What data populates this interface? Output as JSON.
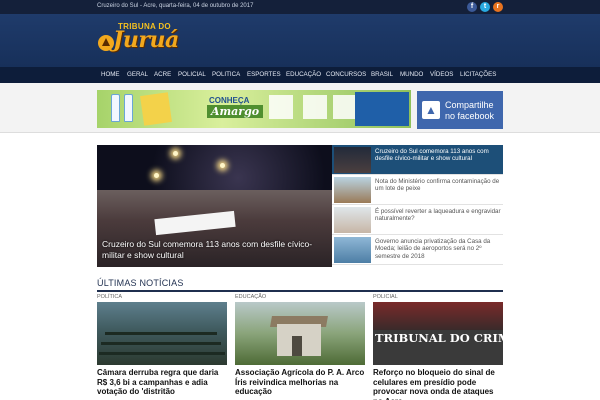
{
  "topbar": {
    "date": "Cruzeiro do Sul - Acre, quarta-feira, 04 de outubro de 2017",
    "social": [
      "f",
      "t",
      "r"
    ]
  },
  "logo": {
    "line1": "TRIBUNA DO",
    "line2": "Juruá"
  },
  "nav": {
    "items": [
      "HOME",
      "GERAL",
      "ACRE",
      "POLICIAL",
      "POLITICA",
      "ESPORTES",
      "EDUCAÇÃO",
      "CONCURSOS",
      "BRASIL",
      "MUNDO",
      "VÍDEOS",
      "LICITAÇÕES"
    ]
  },
  "ad": {
    "headline": "CONHEÇA",
    "brand": "Amargo"
  },
  "facebook_share": {
    "line1": "Compartilhe",
    "line2": "no facebook",
    "icon": "thumbs-up-icon"
  },
  "feature": {
    "caption": "Cruzeiro do Sul comemora 113 anos com desfile cívico-militar e show cultural"
  },
  "side_news": [
    "Cruzeiro do Sul comemora 113 anos com desfile cívico-militar e show cultural",
    "Nota do Ministério confirma contaminação de um lote de peixe",
    "É possível reverter a laqueadura e engravidar naturalmente?",
    "Governo anuncia privatização da Casa da Moeda; leilão de aeroportos será no 2º semestre de 2018"
  ],
  "latest": {
    "title": "ÚLTIMAS NOTÍCIAS",
    "cards": [
      {
        "category": "POLÍTICA",
        "title": "Câmara derruba regra que daria R$ 3,6 bi a campanhas e adia votação do 'distritão"
      },
      {
        "category": "EDUCAÇÃO",
        "title": "Associação Agrícola do P. A. Arco Íris reivindica melhorias na educação"
      },
      {
        "category": "POLICIAL",
        "title": "Reforço no bloqueio do sinal de celulares em presídio pode provocar nova onda de ataques no Acre",
        "image_text": "TRIBUNAL DO CRIME"
      }
    ]
  },
  "colors": {
    "header": "#1f3b6b",
    "nav": "#0d1d3a",
    "accent": "#f2a81d",
    "facebook": "#3f67ad",
    "active_row": "#1d4f78"
  }
}
